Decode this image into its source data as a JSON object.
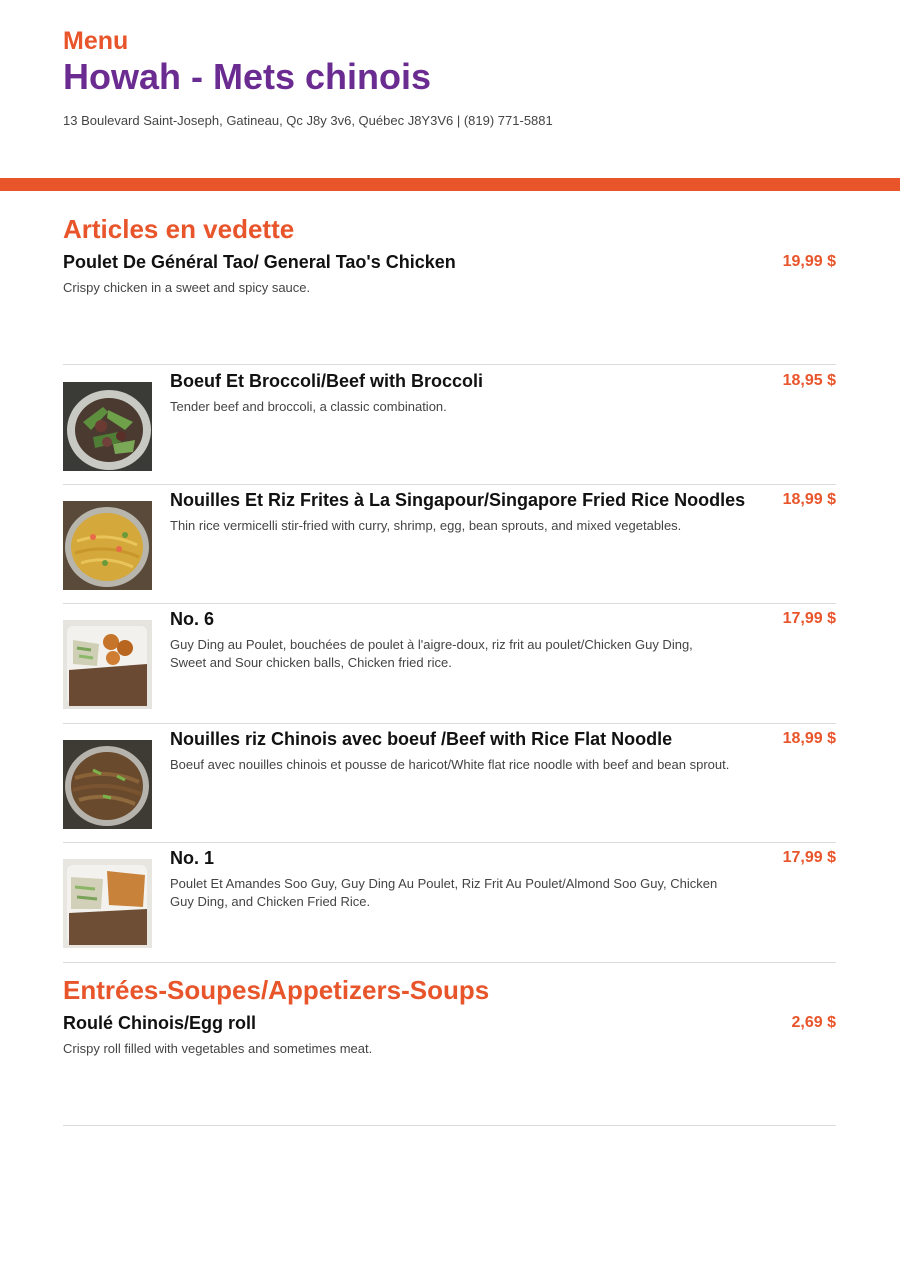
{
  "header": {
    "menu_label": "Menu",
    "restaurant_name": "Howah - Mets chinois",
    "address": "13 Boulevard Saint-Joseph, Gatineau, Qc J8y 3v6, Québec J8Y3V6 | (819) 771-5881"
  },
  "colors": {
    "accent": "#e8552b",
    "title": "#6b2c91"
  },
  "featured": {
    "title": "Articles en vedette",
    "top_item": {
      "name": "Poulet De Général Tao/ General Tao's Chicken",
      "price": "19,99 $",
      "description": "Crispy chicken in a sweet and spicy sauce."
    },
    "items": [
      {
        "name": "Boeuf Et Broccoli/Beef with Broccoli",
        "price": "18,95 $",
        "description": "Tender beef and broccoli, a classic combination.",
        "image": "beef-broccoli-photo"
      },
      {
        "name": "Nouilles Et Riz Frites à La Singapour/Singapore Fried Rice Noodles",
        "price": "18,99 $",
        "description": "Thin rice vermicelli stir-fried with curry, shrimp, egg, bean sprouts, and mixed vegetables.",
        "image": "singapore-noodles-photo"
      },
      {
        "name": "No. 6",
        "price": "17,99 $",
        "description": "Guy Ding au Poulet, bouchées de poulet à l'aigre-doux, riz frit au poulet/Chicken Guy Ding, Sweet and Sour chicken balls, Chicken fried rice.",
        "image": "combo-6-photo"
      },
      {
        "name": "Nouilles riz Chinois avec boeuf /Beef with Rice Flat Noodle",
        "price": "18,99 $",
        "description": "Boeuf avec nouilles chinois et pousse de haricot/White flat rice noodle with beef and bean sprout.",
        "image": "beef-flat-noodle-photo"
      },
      {
        "name": "No. 1",
        "price": "17,99 $",
        "description": "Poulet Et Amandes Soo Guy, Guy Ding Au Poulet, Riz Frit Au Poulet/Almond Soo Guy, Chicken Guy Ding, and Chicken Fried Rice.",
        "image": "combo-1-photo"
      }
    ]
  },
  "appetizers": {
    "title": "Entrées-Soupes/Appetizers-Soups",
    "items": [
      {
        "name": "Roulé Chinois/Egg roll",
        "price": "2,69 $",
        "description": "Crispy roll filled with vegetables and sometimes meat."
      }
    ]
  }
}
